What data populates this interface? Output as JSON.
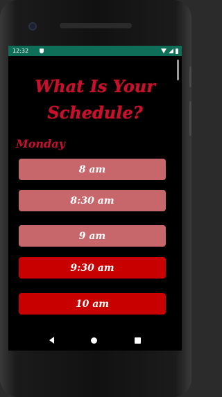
{
  "status_bar": {
    "time": "12:32",
    "background_color": "#0f6e57",
    "icons": [
      "shield-icon",
      "wifi-icon",
      "signal-icon",
      "battery-icon"
    ]
  },
  "page": {
    "title_line1": "What Is Your",
    "title_line2": "Schedule?",
    "day": "Monday",
    "title_color": "#c8102e"
  },
  "time_slots": [
    {
      "label": "8 am",
      "state": "inactive",
      "color": "#c8676b"
    },
    {
      "label": "8:30 am",
      "state": "inactive",
      "color": "#c8676b"
    },
    {
      "label": "9 am",
      "state": "inactive",
      "color": "#c8676b"
    },
    {
      "label": "9:30 am",
      "state": "active",
      "color": "#c80000"
    },
    {
      "label": "10 am",
      "state": "active",
      "color": "#c80000"
    }
  ],
  "nav_bar": {
    "icons": [
      "back-icon",
      "home-icon",
      "recents-icon"
    ]
  }
}
